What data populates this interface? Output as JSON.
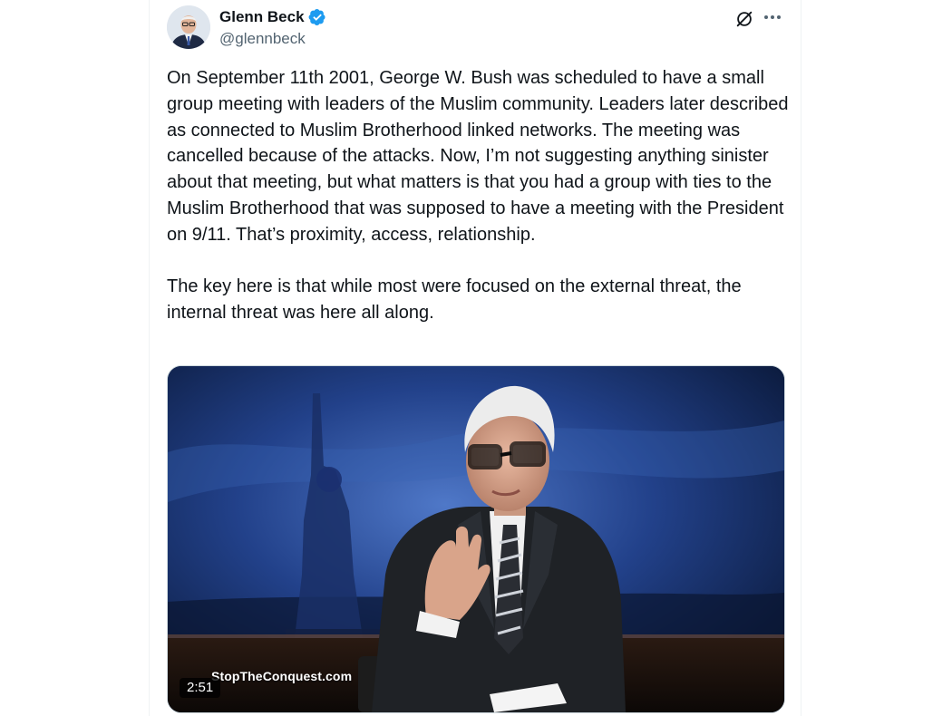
{
  "author": {
    "name": "Glenn Beck",
    "handle": "@glennbeck",
    "verified_color": "#1d9bf0"
  },
  "actions": {
    "grok_icon": "grok-icon",
    "more_icon": "more-icon"
  },
  "tweet": {
    "paragraphs": [
      "On September 11th 2001, George W. Bush was scheduled to have a small group meeting with leaders of the Muslim community. Leaders later described as connected to Muslim Brotherhood linked networks. The meeting was cancelled because of the attacks. Now, I’m not suggesting anything sinister about that meeting, but what matters is that you had a group with ties to the Muslim Brotherhood that was supposed to have a meeting with the President on 9/11. That’s proximity, access, relationship.",
      "The key here is that while most were focused on the external threat, the internal threat was here all along."
    ]
  },
  "video": {
    "watermark": "StopTheConquest.com",
    "duration": "2:51"
  }
}
